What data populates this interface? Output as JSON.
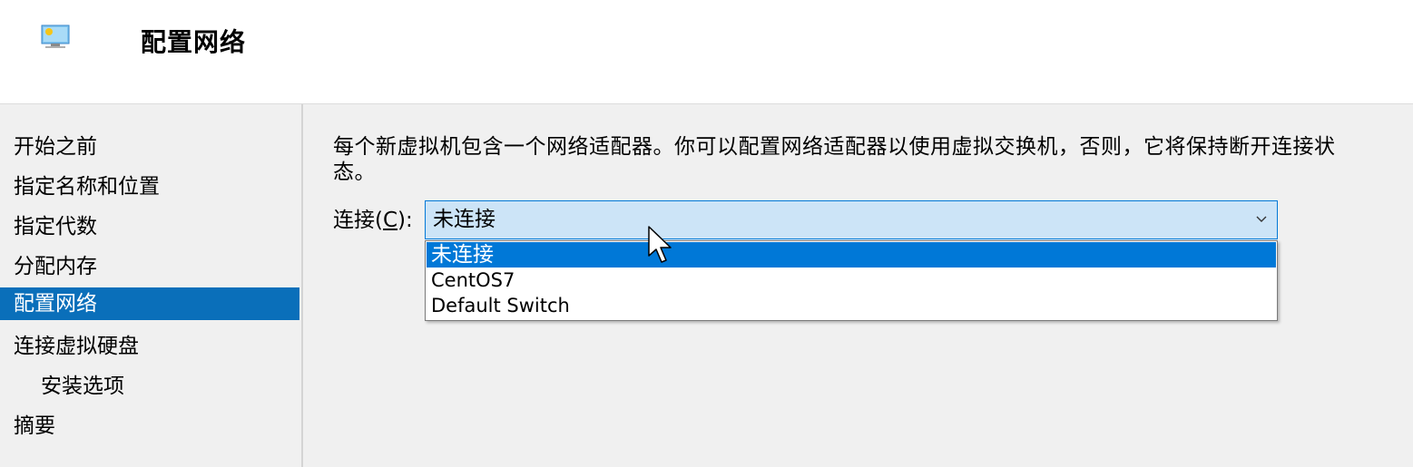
{
  "header": {
    "title": "配置网络",
    "icon": "network-adapter-icon"
  },
  "sidebar": {
    "items": [
      {
        "label": "开始之前",
        "active": false
      },
      {
        "label": "指定名称和位置",
        "active": false
      },
      {
        "label": "指定代数",
        "active": false
      },
      {
        "label": "分配内存",
        "active": false
      },
      {
        "label": "配置网络",
        "active": true
      },
      {
        "label": "连接虚拟硬盘",
        "active": false
      },
      {
        "label": "安装选项",
        "active": false
      },
      {
        "label": "摘要",
        "active": false
      }
    ]
  },
  "main": {
    "description": "每个新虚拟机包含一个网络适配器。你可以配置网络适配器以使用虚拟交换机，否则，它将保持断开连接状态。",
    "connection": {
      "label_prefix": "连接(",
      "label_accel": "C",
      "label_suffix": "):",
      "selected_value": "未连接",
      "options": [
        "未连接",
        "CentOS7",
        "Default Switch"
      ]
    }
  },
  "colors": {
    "accent": "#0078d7",
    "nav_active": "#0a6fba",
    "select_bg": "#cce4f7",
    "background": "#f0f0f0"
  }
}
